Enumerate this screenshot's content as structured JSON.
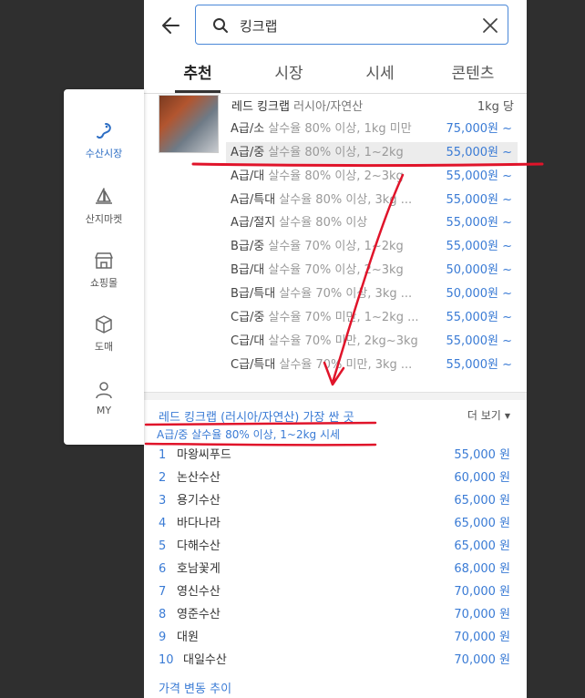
{
  "search": {
    "value": "킹크랩"
  },
  "tabs": [
    {
      "label": "추천",
      "active": true
    },
    {
      "label": "시장",
      "active": false
    },
    {
      "label": "시세",
      "active": false
    },
    {
      "label": "콘텐츠",
      "active": false
    }
  ],
  "product": {
    "title": "레드 킹크랩",
    "origin": "러시아/자연산",
    "unit": "1kg 당"
  },
  "grades": [
    {
      "grade": "A급/소",
      "desc": "살수율 80% 이상, 1kg 미만",
      "price": "75,000원 ~"
    },
    {
      "grade": "A급/중",
      "desc": "살수율 80% 이상, 1~2kg",
      "price": "55,000원 ~"
    },
    {
      "grade": "A급/대",
      "desc": "살수율 80% 이상, 2~3kg",
      "price": "55,000원 ~"
    },
    {
      "grade": "A급/특대",
      "desc": "살수율 80% 이상, 3kg ...",
      "price": "55,000원 ~"
    },
    {
      "grade": "A급/절지",
      "desc": "살수율 80% 이상",
      "price": "55,000원 ~"
    },
    {
      "grade": "B급/중",
      "desc": "살수율 70% 이상, 1~2kg",
      "price": "55,000원 ~"
    },
    {
      "grade": "B급/대",
      "desc": "살수율 70% 이상, 2~3kg",
      "price": "50,000원 ~"
    },
    {
      "grade": "B급/특대",
      "desc": "살수율 70% 이상, 3kg ...",
      "price": "50,000원 ~"
    },
    {
      "grade": "C급/중",
      "desc": "살수율 70% 미만, 1~2kg ...",
      "price": "55,000원 ~"
    },
    {
      "grade": "C급/대",
      "desc": "살수율 70% 미만, 2kg~3kg",
      "price": "55,000원 ~"
    },
    {
      "grade": "C급/특대",
      "desc": "살수율 70% 미만, 3kg ...",
      "price": "55,000원 ~"
    }
  ],
  "cheapest": {
    "title": "레드 킹크랩 (러시아/자연산) 가장 싼 곳",
    "subtitle": "A급/중 살수율 80% 이상, 1~2kg 시세",
    "more_label": "더 보기",
    "shops": [
      {
        "rank": "1",
        "name": "마왕씨푸드",
        "price": "55,000 원"
      },
      {
        "rank": "2",
        "name": "논산수산",
        "price": "60,000 원"
      },
      {
        "rank": "3",
        "name": "용기수산",
        "price": "65,000 원"
      },
      {
        "rank": "4",
        "name": "바다나라",
        "price": "65,000 원"
      },
      {
        "rank": "5",
        "name": "다해수산",
        "price": "65,000 원"
      },
      {
        "rank": "6",
        "name": "호남꽃게",
        "price": "68,000 원"
      },
      {
        "rank": "7",
        "name": "영신수산",
        "price": "70,000 원"
      },
      {
        "rank": "8",
        "name": "영준수산",
        "price": "70,000 원"
      },
      {
        "rank": "9",
        "name": "대원",
        "price": "70,000 원"
      },
      {
        "rank": "10",
        "name": "대일수산",
        "price": "70,000 원"
      }
    ],
    "trend_label": "가격 변동 추이"
  },
  "sidenav": [
    {
      "label": "수산시장",
      "icon": "fish-hook-icon",
      "active": true
    },
    {
      "label": "산지마켓",
      "icon": "sailboat-icon",
      "active": false
    },
    {
      "label": "쇼핑몰",
      "icon": "store-icon",
      "active": false
    },
    {
      "label": "도매",
      "icon": "box-icon",
      "active": false
    },
    {
      "label": "MY",
      "icon": "user-icon",
      "active": false
    }
  ],
  "colors": {
    "accent": "#3a7bd5",
    "annotation": "#e0142a",
    "background": "#2f2f2f"
  }
}
